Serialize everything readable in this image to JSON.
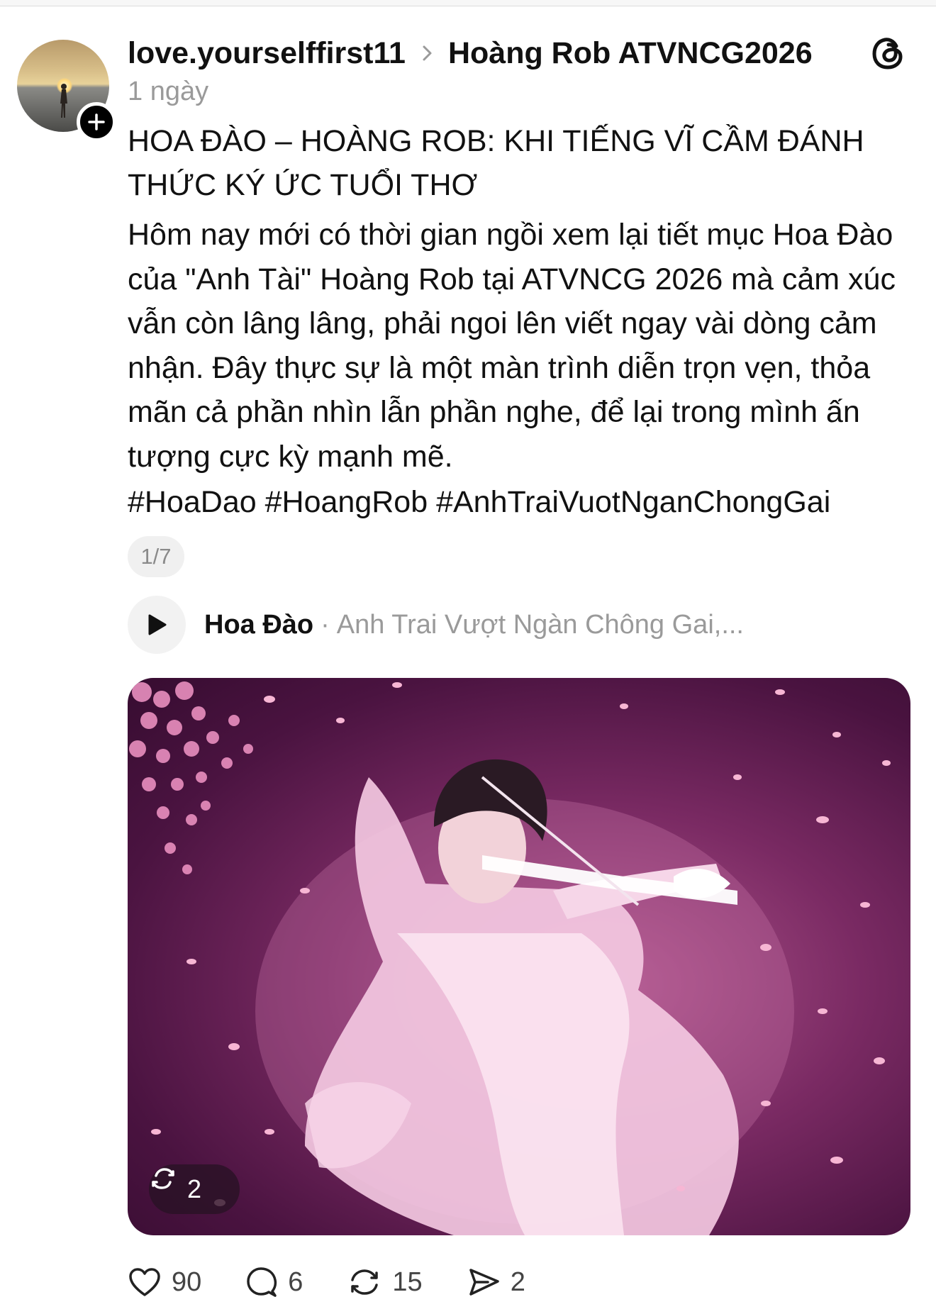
{
  "post": {
    "author": "love.yourselffirst11",
    "community": "Hoàng Rob ATVNCG2026",
    "time": "1 ngày",
    "title": "HOA ĐÀO – HOÀNG ROB: KHI TIẾNG VĨ CẦM ĐÁNH THỨC KÝ ỨC TUỔI THƠ",
    "body": "Hôm nay mới có thời gian ngồi xem lại tiết mục Hoa Đào của \"Anh Tài\" Hoàng Rob tại ATVNCG 2026 mà cảm xúc vẫn còn lâng lâng, phải ngoi lên viết ngay vài dòng cảm nhận. Đây thực sự là một màn trình diễn trọn vẹn, thỏa mãn cả phần nhìn lẫn phần nghe, để lại trong mình ấn tượng cực kỳ mạnh mẽ.",
    "hashtags": "#HoaDao #HoangRob #AnhTraiVuotNganChongGai",
    "page_indicator": "1/7"
  },
  "music": {
    "title": "Hoa Đào",
    "separator": "·",
    "artist": "Anh Trai Vượt Ngàn Chông Gai,..."
  },
  "media": {
    "repost_count": "2"
  },
  "actions": {
    "likes": "90",
    "comments": "6",
    "reposts": "15",
    "shares": "2"
  },
  "icons": {
    "follow": "plus-icon",
    "breadcrumb": "chevron-right-icon",
    "logo": "threads-logo-icon",
    "play": "play-icon",
    "repost_badge": "repost-icon",
    "like": "heart-icon",
    "comment": "comment-icon",
    "repost": "repost-icon",
    "share": "send-icon"
  },
  "colors": {
    "text": "#111111",
    "muted": "#9a9a9a",
    "media_bg": "#7a2a63",
    "petal": "#f7b6d4"
  }
}
